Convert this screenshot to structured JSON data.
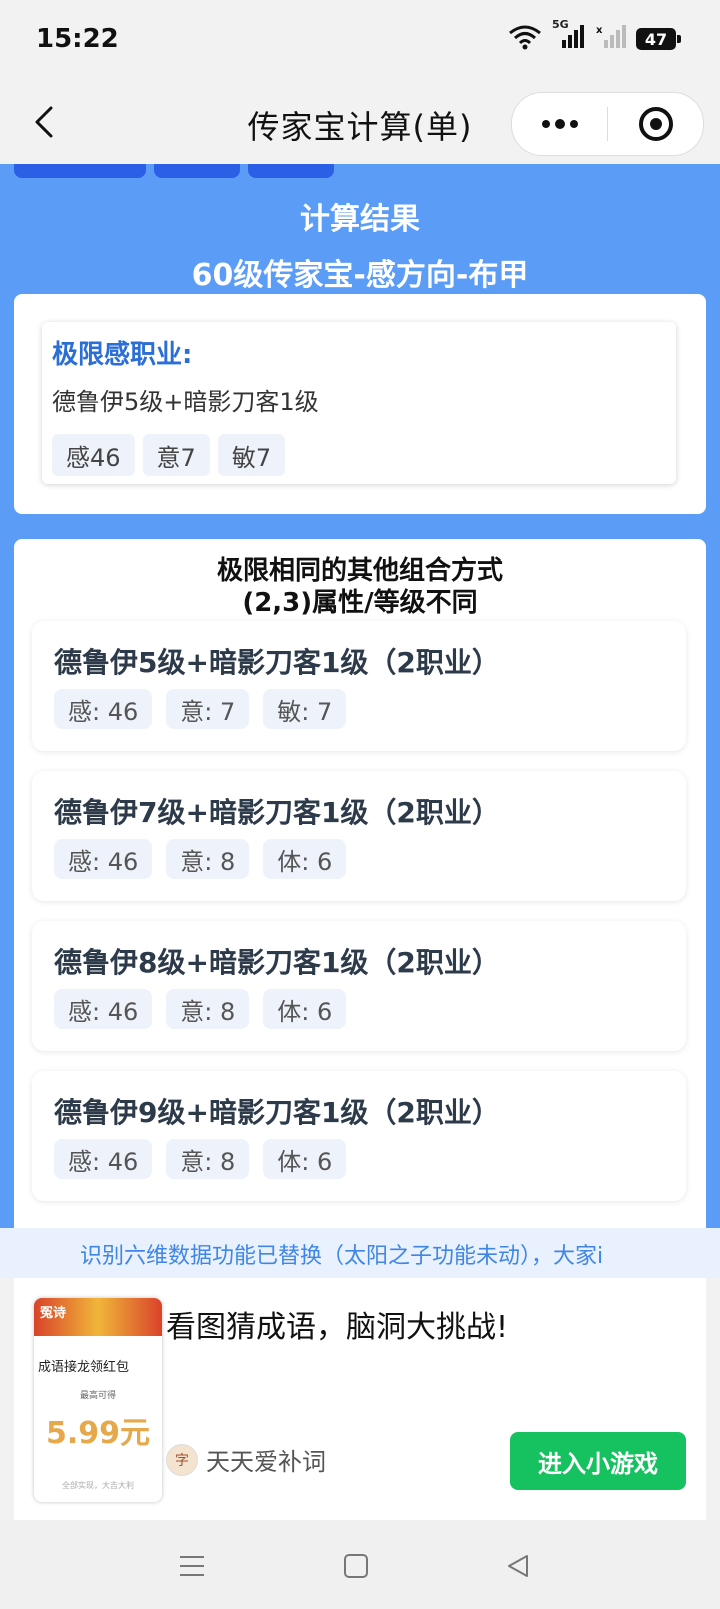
{
  "status_bar": {
    "time": "15:22",
    "network": "5G",
    "battery": "47"
  },
  "nav": {
    "title": "传家宝计算(单)"
  },
  "result": {
    "title": "计算结果",
    "subtitle": "60级传家宝-感方向-布甲"
  },
  "limit": {
    "heading": "极限感职业:",
    "combo": "德鲁伊5级+暗影刀客1级",
    "stats": [
      "感46",
      "意7",
      "敏7"
    ]
  },
  "others": {
    "title_line1": "极限相同的其他组合方式",
    "title_line2": "(2,3)属性/等级不同",
    "items": [
      {
        "name": "德鲁伊5级+暗影刀客1级（2职业）",
        "stats": [
          "感: 46",
          "意: 7",
          "敏: 7"
        ]
      },
      {
        "name": "德鲁伊7级+暗影刀客1级（2职业）",
        "stats": [
          "感: 46",
          "意: 8",
          "体: 6"
        ]
      },
      {
        "name": "德鲁伊8级+暗影刀客1级（2职业）",
        "stats": [
          "感: 46",
          "意: 8",
          "体: 6"
        ]
      },
      {
        "name": "德鲁伊9级+暗影刀客1级（2职业）",
        "stats": [
          "感: 46",
          "意: 8",
          "体: 6"
        ]
      }
    ]
  },
  "notice": {
    "text": "识别六维数据功能已替换（太阳之子功能未动），大家i"
  },
  "ad": {
    "thumb_banner": "冤诗",
    "thumb_line": "成语接龙领红包",
    "thumb_small": "最高可得",
    "thumb_price": "5.99元",
    "thumb_foot": "全部实现，大吉大利",
    "headline": "看图猜成语，脑洞大挑战!",
    "app_icon_char": "字",
    "app_name": "天天爱补词",
    "cta": "进入小游戏"
  },
  "colors": {
    "primary_blue": "#5b9cf6",
    "button_blue": "#2a5fe6",
    "heading_blue": "#2a6ed6",
    "cta_green": "#16c25f"
  }
}
